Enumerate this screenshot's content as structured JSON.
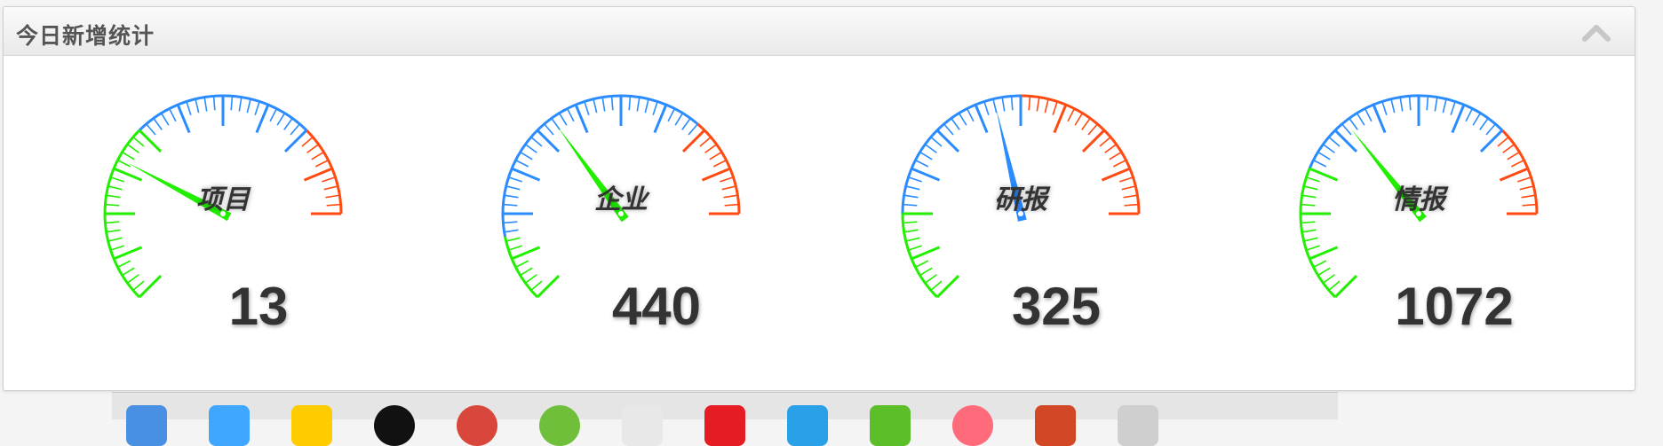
{
  "panel": {
    "title": "今日新增统计",
    "collapse_icon": "chevron-up-icon"
  },
  "colors": {
    "low": "#22ee00",
    "mid": "#2a8cff",
    "high": "#ff4a12",
    "text": "#333333"
  },
  "gauges": [
    {
      "label": "项目",
      "value": "13",
      "needle_value": 13,
      "needle_color": "#22ee00"
    },
    {
      "label": "企业",
      "value": "440",
      "needle_value": 440,
      "needle_color": "#22ee00"
    },
    {
      "label": "研报",
      "value": "325",
      "needle_value": 325,
      "needle_color": "#2a8cff"
    },
    {
      "label": "情报",
      "value": "1072",
      "needle_value": 1072,
      "needle_color": "#22ee00"
    }
  ],
  "gauge_scales": [
    {
      "min": 0,
      "max": 40,
      "bands": [
        {
          "to": 16,
          "color": "low"
        },
        {
          "to": 32,
          "color": "mid"
        },
        {
          "to": 40,
          "color": "high"
        }
      ]
    },
    {
      "min": 0,
      "max": 1000,
      "bands": [
        {
          "to": 150,
          "color": "low"
        },
        {
          "to": 780,
          "color": "mid"
        },
        {
          "to": 1000,
          "color": "high"
        }
      ]
    },
    {
      "min": 0,
      "max": 600,
      "bands": [
        {
          "to": 120,
          "color": "low"
        },
        {
          "to": 360,
          "color": "mid"
        },
        {
          "to": 600,
          "color": "high"
        }
      ]
    },
    {
      "min": 0,
      "max": 2500,
      "bands": [
        {
          "to": 750,
          "color": "low"
        },
        {
          "to": 2000,
          "color": "mid"
        },
        {
          "to": 2500,
          "color": "high"
        }
      ]
    }
  ],
  "taskbar": {
    "icons": [
      "finder-icon",
      "safari-icon",
      "notes-icon",
      "app-icon",
      "red-app-icon",
      "green-app-icon",
      "calendar-icon",
      "app-icon",
      "leaf-icon",
      "music-icon",
      "presentation-icon",
      "window-icon",
      "window-icon"
    ]
  }
}
